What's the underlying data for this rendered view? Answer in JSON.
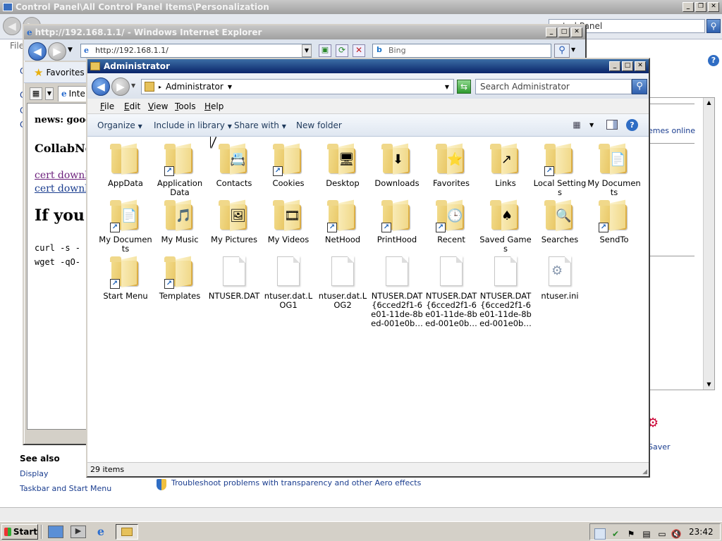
{
  "control_panel": {
    "title": "Control Panel\\All Control Panel Items\\Personalization",
    "search_value": "ontrol Panel",
    "menu_file": "File",
    "see_also": "See also",
    "links": [
      "Display",
      "Taskbar and Start Menu"
    ],
    "troubleshoot": "Troubleshoot problems with transparency and other Aero effects",
    "themes_online": "emes online",
    "screensaver": "Saver",
    "left_letters": [
      "C",
      "C",
      "C",
      "C"
    ]
  },
  "ie": {
    "title": "http://192.168.1.1/ - Windows Internet Explorer",
    "address": "http://192.168.1.1/",
    "search_placeholder": "Bing",
    "favorites": "Favorites",
    "tab_label": "Inte",
    "content": {
      "line1": "news: goog",
      "heading1": "CollabNe",
      "link1": "cert downloa",
      "link2": "cert downloa",
      "heading2": "If you a",
      "code1": "curl -s -",
      "code2": "wget -qO-"
    }
  },
  "explorer": {
    "title": "Administrator",
    "breadcrumb": "Administrator",
    "search_placeholder": "Search Administrator",
    "menu": [
      "File",
      "Edit",
      "View",
      "Tools",
      "Help"
    ],
    "commands": {
      "organize": "Organize",
      "include": "Include in library",
      "share": "Share with",
      "new_folder": "New folder"
    },
    "status": "29 items",
    "items": [
      {
        "label": "AppData",
        "kind": "folder",
        "icon": "folder-icon",
        "shortcut": false
      },
      {
        "label": "Application Data",
        "kind": "folder",
        "icon": "folder-icon",
        "shortcut": true
      },
      {
        "label": "Contacts",
        "kind": "folder",
        "icon": "contacts-folder-icon",
        "shortcut": false,
        "badge": "📇"
      },
      {
        "label": "Cookies",
        "kind": "folder",
        "icon": "folder-icon",
        "shortcut": true
      },
      {
        "label": "Desktop",
        "kind": "folder",
        "icon": "desktop-folder-icon",
        "shortcut": false,
        "badge": "🖥"
      },
      {
        "label": "Downloads",
        "kind": "folder",
        "icon": "downloads-folder-icon",
        "shortcut": false,
        "badge": "⬇"
      },
      {
        "label": "Favorites",
        "kind": "folder",
        "icon": "favorites-folder-icon",
        "shortcut": false,
        "badge": "⭐"
      },
      {
        "label": "Links",
        "kind": "folder",
        "icon": "links-folder-icon",
        "shortcut": false,
        "badge": "↗"
      },
      {
        "label": "Local Settings",
        "kind": "folder",
        "icon": "folder-icon",
        "shortcut": true
      },
      {
        "label": "My Documents",
        "kind": "folder",
        "icon": "documents-folder-icon",
        "shortcut": false,
        "badge": "📄"
      },
      {
        "label": "My Documents",
        "kind": "folder",
        "icon": "documents-folder-icon",
        "shortcut": true,
        "badge": "📄"
      },
      {
        "label": "My Music",
        "kind": "folder",
        "icon": "music-folder-icon",
        "shortcut": false,
        "badge": "🎵"
      },
      {
        "label": "My Pictures",
        "kind": "folder",
        "icon": "pictures-folder-icon",
        "shortcut": false,
        "badge": "🖼"
      },
      {
        "label": "My Videos",
        "kind": "folder",
        "icon": "videos-folder-icon",
        "shortcut": false,
        "badge": "🎞"
      },
      {
        "label": "NetHood",
        "kind": "folder",
        "icon": "folder-icon",
        "shortcut": true
      },
      {
        "label": "PrintHood",
        "kind": "folder",
        "icon": "folder-icon",
        "shortcut": true
      },
      {
        "label": "Recent",
        "kind": "folder",
        "icon": "recent-folder-icon",
        "shortcut": true,
        "badge": "🕒"
      },
      {
        "label": "Saved Games",
        "kind": "folder",
        "icon": "saved-games-folder-icon",
        "shortcut": false,
        "badge": "♠"
      },
      {
        "label": "Searches",
        "kind": "folder",
        "icon": "searches-folder-icon",
        "shortcut": false,
        "badge": "🔍"
      },
      {
        "label": "SendTo",
        "kind": "folder",
        "icon": "folder-icon",
        "shortcut": true
      },
      {
        "label": "Start Menu",
        "kind": "folder",
        "icon": "folder-icon",
        "shortcut": true
      },
      {
        "label": "Templates",
        "kind": "folder",
        "icon": "folder-icon",
        "shortcut": true
      },
      {
        "label": "NTUSER.DAT",
        "kind": "doc",
        "icon": "file-icon",
        "shortcut": false
      },
      {
        "label": "ntuser.dat.LOG1",
        "kind": "doc",
        "icon": "file-icon",
        "shortcut": false
      },
      {
        "label": "ntuser.dat.LOG2",
        "kind": "doc",
        "icon": "file-icon",
        "shortcut": false
      },
      {
        "label": "NTUSER.DAT{6cced2f1-6e01-11de-8bed-001e0b…",
        "kind": "doc",
        "icon": "file-icon",
        "shortcut": false
      },
      {
        "label": "NTUSER.DAT{6cced2f1-6e01-11de-8bed-001e0b…",
        "kind": "doc",
        "icon": "file-icon",
        "shortcut": false
      },
      {
        "label": "NTUSER.DAT{6cced2f1-6e01-11de-8bed-001e0b…",
        "kind": "doc",
        "icon": "file-icon",
        "shortcut": false
      },
      {
        "label": "ntuser.ini",
        "kind": "ini",
        "icon": "settings-file-icon",
        "shortcut": false
      }
    ]
  },
  "taskbar": {
    "start": "Start",
    "clock": "23:42"
  },
  "colors": {
    "title_active": "#0a246a",
    "title_inactive": "#a0a0a0",
    "link": "#1a3d8f",
    "visited": "#6b1f7b"
  }
}
